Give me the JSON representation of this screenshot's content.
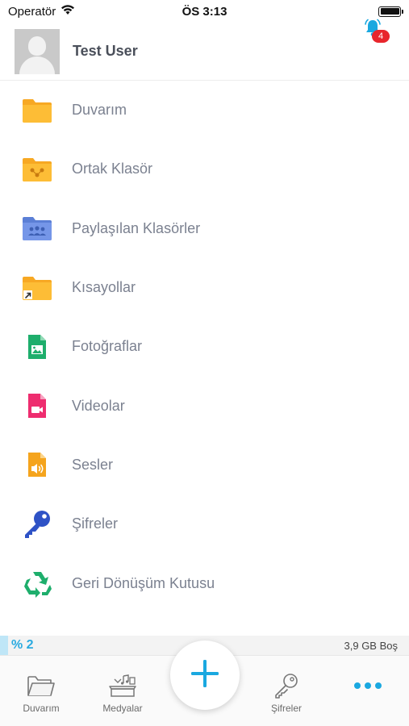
{
  "status_bar": {
    "carrier": "Operatör",
    "time": "ÖS 3:13",
    "battery_level": 1.0
  },
  "header": {
    "user_name": "Test User",
    "notification_count": "4"
  },
  "menu": {
    "items": [
      {
        "label": "Duvarım",
        "icon": "folder-icon"
      },
      {
        "label": "Ortak Klasör",
        "icon": "shared-folder-icon"
      },
      {
        "label": "Paylaşılan Klasörler",
        "icon": "group-folder-icon"
      },
      {
        "label": "Kısayollar",
        "icon": "shortcut-folder-icon"
      },
      {
        "label": "Fotoğraflar",
        "icon": "photo-file-icon"
      },
      {
        "label": "Videolar",
        "icon": "video-file-icon"
      },
      {
        "label": "Sesler",
        "icon": "audio-file-icon"
      },
      {
        "label": "Şifreler",
        "icon": "key-icon"
      },
      {
        "label": "Geri Dönüşüm Kutusu",
        "icon": "recycle-icon"
      }
    ]
  },
  "storage": {
    "percent_label": "% 2",
    "used_fraction": 0.02,
    "free_label": "3,9 GB Boş"
  },
  "tab_bar": {
    "tabs": [
      {
        "label": "Duvarım",
        "icon": "folder-outline-icon"
      },
      {
        "label": "Medyalar",
        "icon": "media-icon"
      },
      {
        "label": "Şifreler",
        "icon": "key-outline-icon"
      }
    ],
    "add_icon": "plus-icon",
    "more_icon": "more-dots-icon"
  },
  "colors": {
    "accent": "#1aa8e0",
    "folder": "#fdb62c",
    "badge": "#e8262c"
  }
}
